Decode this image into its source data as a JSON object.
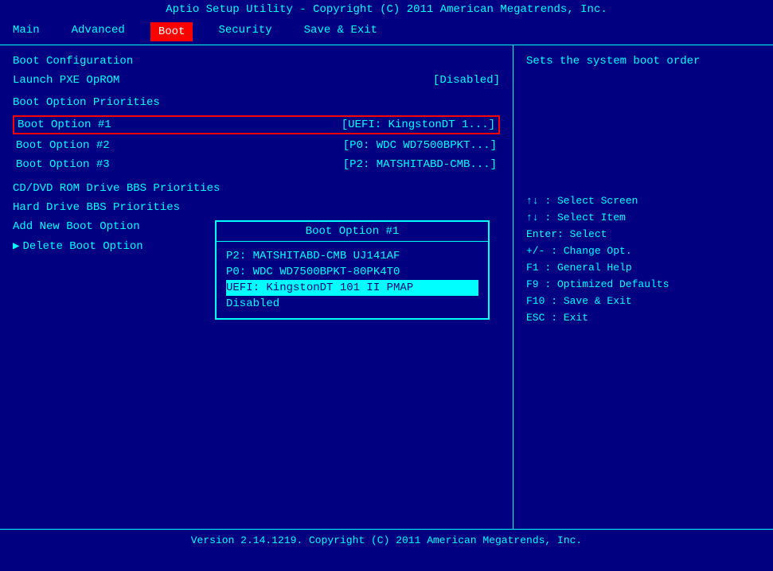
{
  "title": "Aptio Setup Utility - Copyright (C) 2011 American Megatrends, Inc.",
  "menu": {
    "items": [
      {
        "id": "main",
        "label": "Main",
        "active": false
      },
      {
        "id": "advanced",
        "label": "Advanced",
        "active": false
      },
      {
        "id": "boot",
        "label": "Boot",
        "active": true
      },
      {
        "id": "security",
        "label": "Security",
        "active": false
      },
      {
        "id": "save-exit",
        "label": "Save & Exit",
        "active": false
      }
    ]
  },
  "left": {
    "boot_configuration_label": "Boot Configuration",
    "launch_pxe_label": "Launch PXE OpROM",
    "launch_pxe_value": "[Disabled]",
    "boot_option_priorities_label": "Boot Option Priorities",
    "boot_option_1_label": "Boot Option #1",
    "boot_option_1_value": "[UEFI: KingstonDT 1...]",
    "boot_option_2_label": "Boot Option #2",
    "boot_option_2_value": "[P0: WDC WD7500BPKT...]",
    "boot_option_3_label": "Boot Option #3",
    "boot_option_3_value": "[P2: MATSHITABD-CMB...]",
    "cd_dvd_label": "CD/DVD ROM Drive BBS Priorities",
    "hard_drive_label": "Hard Drive BBS Priorities",
    "add_boot_label": "Add New Boot Option",
    "delete_boot_label": "Delete Boot Option"
  },
  "popup": {
    "title": "Boot Option #1",
    "options": [
      {
        "id": "opt1",
        "label": "P2: MATSHITABD-CMB UJ141AF",
        "selected": false
      },
      {
        "id": "opt2",
        "label": "P0: WDC WD7500BPKT-80PK4T0",
        "selected": false
      },
      {
        "id": "opt3",
        "label": "UEFI: KingstonDT 101 II PMAP",
        "selected": true
      },
      {
        "id": "opt4",
        "label": "Disabled",
        "selected": false
      }
    ]
  },
  "right": {
    "help_text": "Sets the system boot order",
    "keys": [
      {
        "key": "↑↓",
        "desc": ": Select Screen"
      },
      {
        "key": "↑↓",
        "desc": ": Select Item"
      },
      {
        "key": "Enter",
        "desc": ": Select"
      },
      {
        "key": "+/-",
        "desc": ": Change Opt."
      },
      {
        "key": "F1",
        "desc": ": General Help"
      },
      {
        "key": "F9",
        "desc": ": Optimized Defaults"
      },
      {
        "key": "F10",
        "desc": ": Save & Exit"
      },
      {
        "key": "ESC",
        "desc": ": Exit"
      }
    ]
  },
  "footer": "Version 2.14.1219. Copyright (C) 2011 American Megatrends, Inc."
}
